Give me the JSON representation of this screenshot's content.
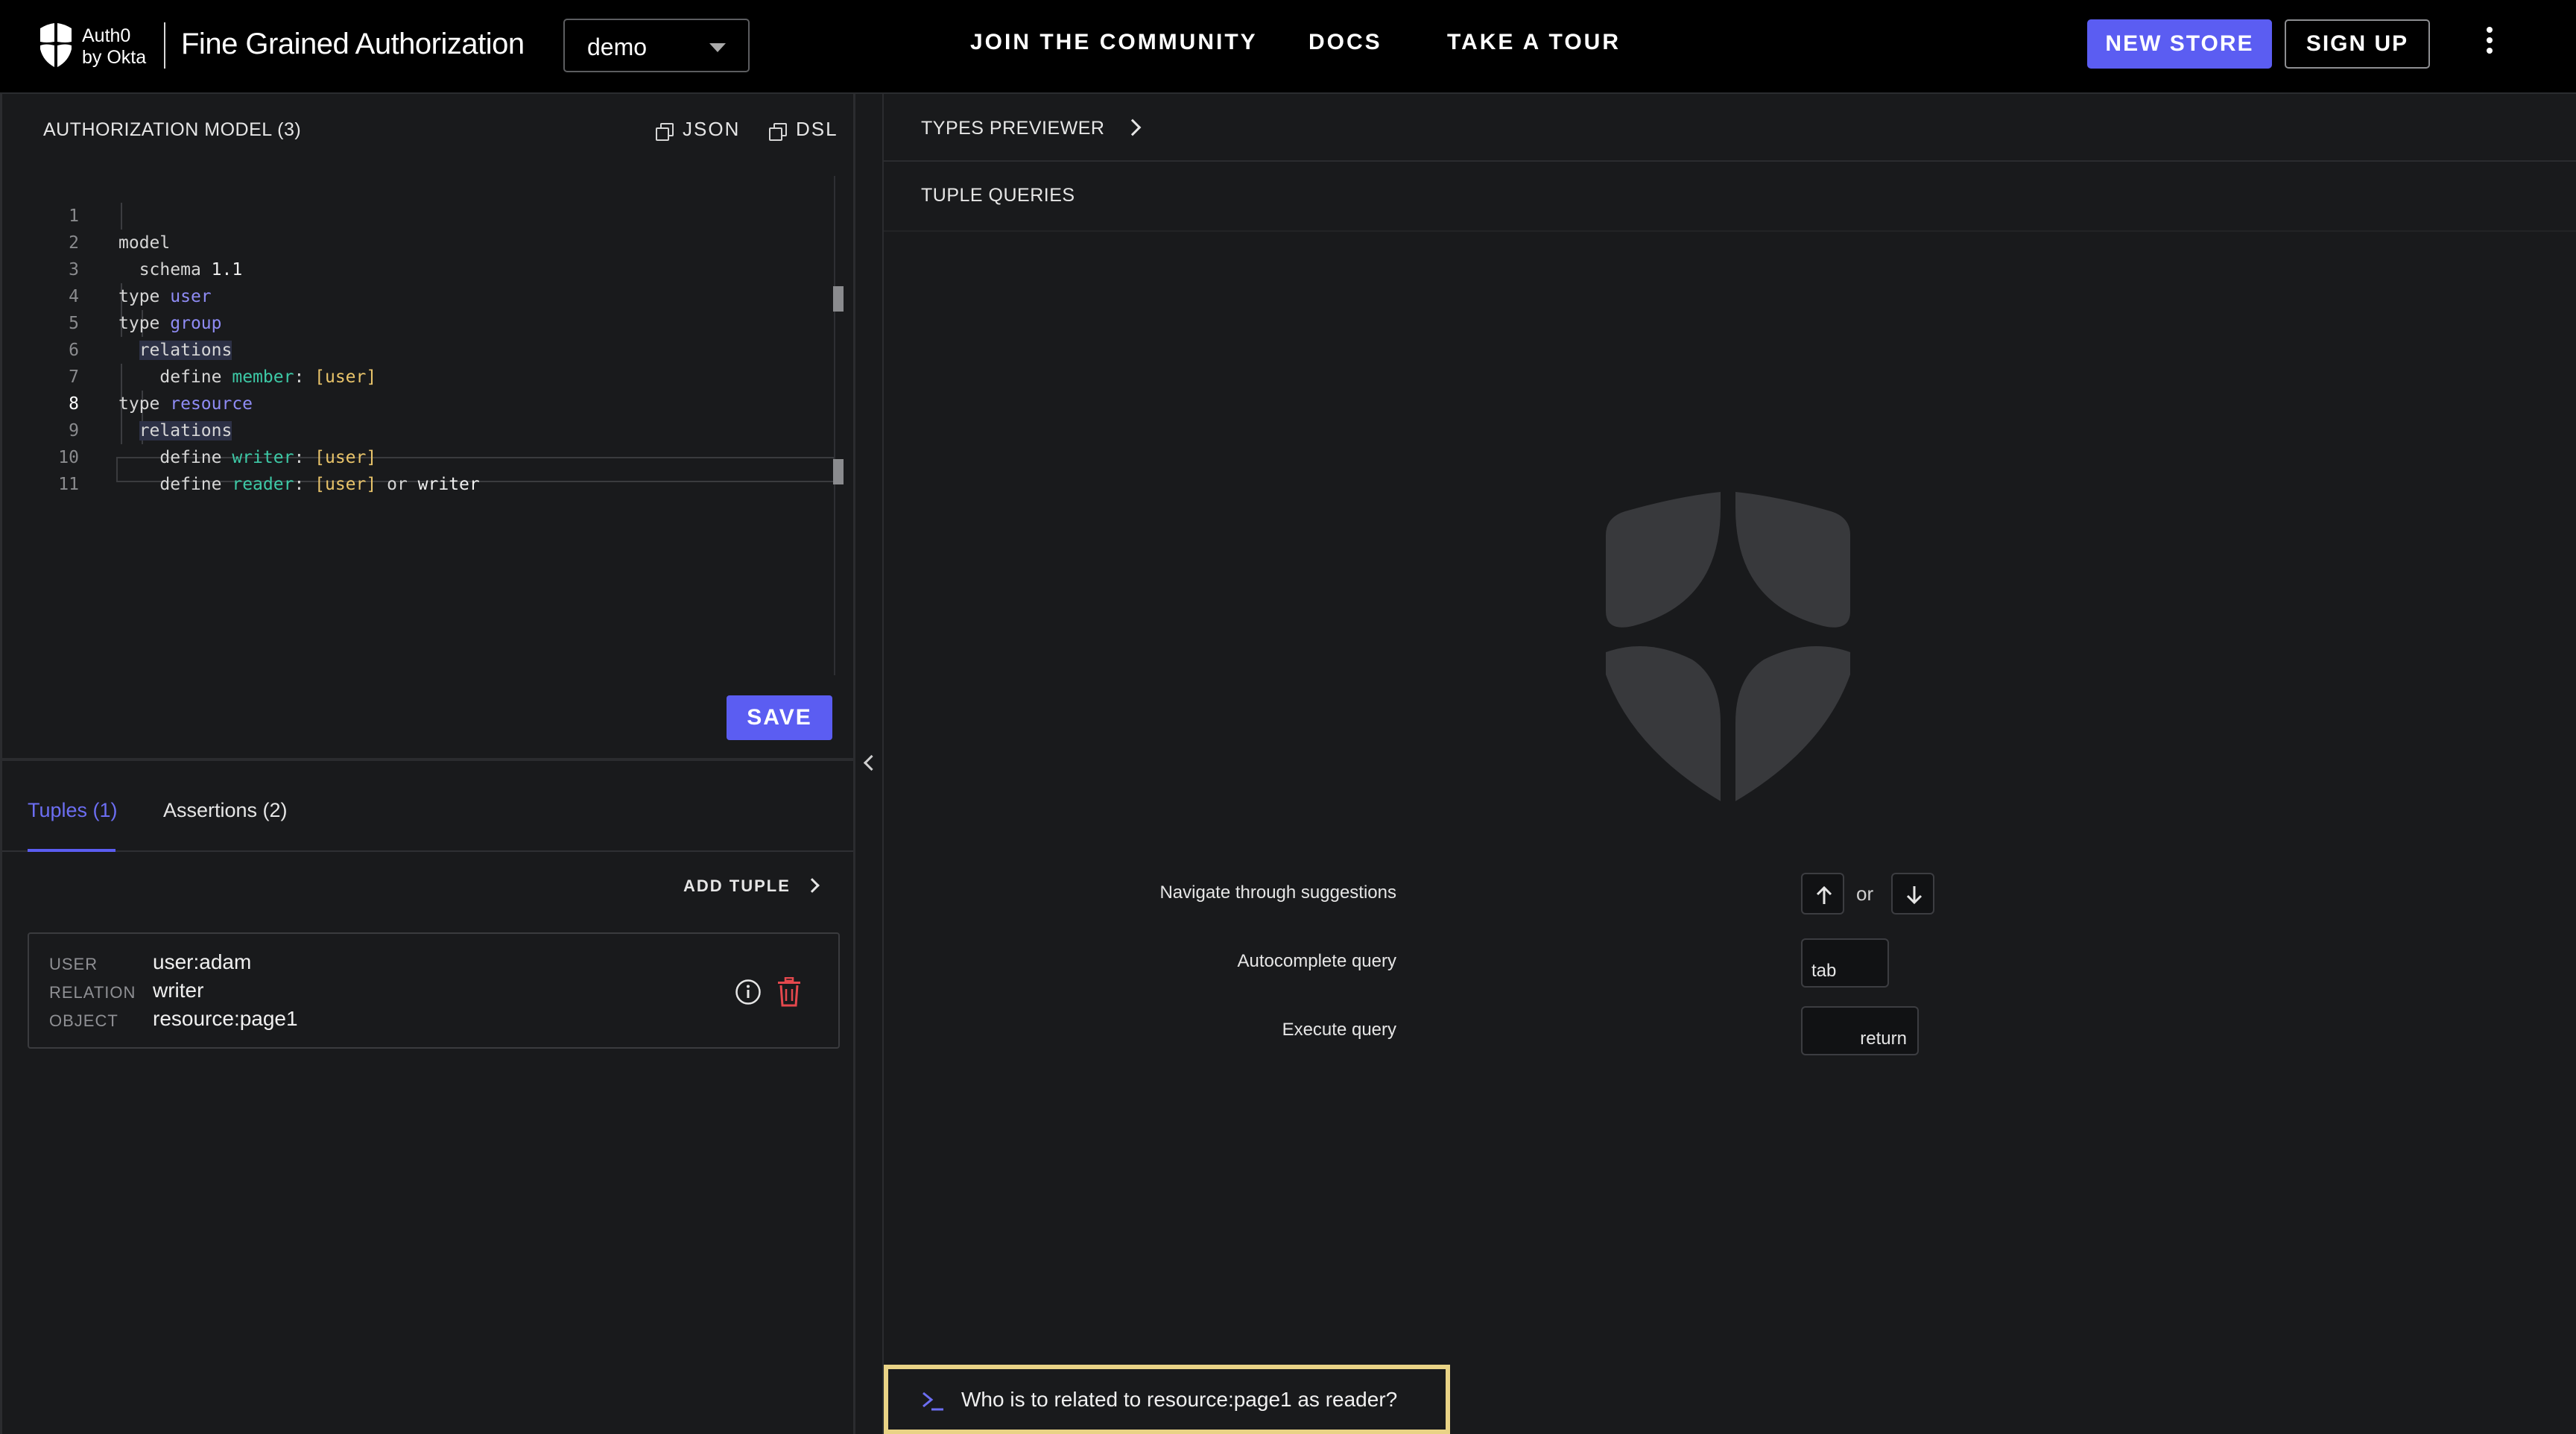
{
  "brand": {
    "small_line1": "Auth0",
    "small_line2": "by Okta",
    "title": "Fine Grained Authorization"
  },
  "store_select": {
    "value": "demo"
  },
  "nav": {
    "community": "JOIN  THE COMMUNITY",
    "docs": "DOCS",
    "tour": "TAKE  A  TOUR"
  },
  "buttons": {
    "new_store": "NEW STORE",
    "sign_up": "SIGN UP",
    "save": "SAVE"
  },
  "auth_model": {
    "title": "AUTHORIZATION MODEL (3)",
    "json_label": "JSON",
    "dsl_label": "DSL",
    "active_line": 8,
    "line_numbers": [
      "1",
      "2",
      "3",
      "4",
      "5",
      "6",
      "7",
      "8",
      "9",
      "10",
      "11"
    ],
    "lines": [
      {
        "kw": "model"
      },
      {
        "kw": "schema",
        "val": "1.1"
      },
      {
        "kw": "type",
        "name": "user"
      },
      {
        "kw": "type",
        "name": "group"
      },
      {
        "kw": "relations"
      },
      {
        "kw": "define",
        "rel": "member",
        "type": "[user]"
      },
      {
        "kw": "type",
        "name": "resource"
      },
      {
        "kw": "relations"
      },
      {
        "kw": "define",
        "rel": "writer",
        "type": "[user]"
      },
      {
        "kw": "define",
        "rel": "reader",
        "type": "[user]",
        "or": "or",
        "other": "writer"
      },
      {}
    ]
  },
  "tabs": {
    "tuples": "Tuples (1)",
    "assertions": "Assertions (2)"
  },
  "add_tuple": "ADD TUPLE",
  "tuple": {
    "user_key": "USER",
    "user_val": "user:adam",
    "relation_key": "RELATION",
    "relation_val": "writer",
    "object_key": "OBJECT",
    "object_val": "resource:page1"
  },
  "right": {
    "types_previewer": "TYPES PREVIEWER",
    "tuple_queries": "TUPLE QUERIES",
    "hint_navigate": "Navigate through suggestions",
    "or": "or",
    "hint_autocomplete": "Autocomplete query",
    "key_tab": "tab",
    "hint_execute": "Execute query",
    "key_return": "return",
    "query": "Who is to related to resource:page1 as reader?"
  },
  "colors": {
    "accent": "#5b5df2",
    "delete": "#e5484d",
    "query_border": "#e9d386"
  }
}
